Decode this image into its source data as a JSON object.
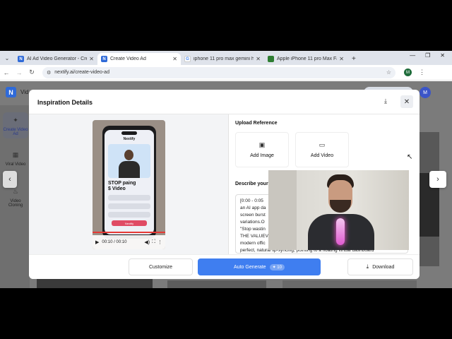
{
  "browser": {
    "tabs": [
      {
        "label": "AI Ad Video Generator - Create",
        "active": false,
        "favicon": "N",
        "favicon_color": "#2f6ad8"
      },
      {
        "label": "Create Video Ad",
        "active": true,
        "favicon": "N",
        "favicon_color": "#2f6ad8"
      },
      {
        "label": "iphone 11 pro max gemini help",
        "active": false,
        "favicon": "G",
        "favicon_color": "#4285f4"
      },
      {
        "label": "Apple iPhone 11 pro Max Facto",
        "active": false,
        "favicon": "",
        "favicon_color": "#2e7d32"
      }
    ],
    "close_glyph": "✕",
    "new_tab": "+",
    "url": "nextify.ai/create-video-ad",
    "profile_initial": "M"
  },
  "app": {
    "logo": "N",
    "name": "Vid",
    "user_initial": "M"
  },
  "sidebar": {
    "items": [
      {
        "label": "Create Video Ad",
        "icon": "sparkle-icon"
      },
      {
        "label": "Viral Video",
        "icon": "film-icon"
      },
      {
        "label": "Video Cloning",
        "icon": "flame-icon"
      }
    ]
  },
  "modal": {
    "title": "Inspiration Details",
    "upload_reference_label": "Upload Reference",
    "add_image_label": "Add Image",
    "add_video_label": "Add Video",
    "describe_label": "Describe your",
    "description": "[0:00 - 0:05\nan AI app da\nscreen burst\nvariations.O\n\"Stop wastin\nTHE VALUEV\nmodern offic\nperfect, natural lip-syncing, pointing to a floating virtual dashboard",
    "customize_label": "Customize",
    "auto_generate_label": "Auto Generate",
    "auto_generate_credits": "10",
    "download_label": "Download"
  },
  "video": {
    "time": "00:10 / 00:10",
    "progress": 1.0,
    "phone_brand": "Nextify",
    "phone_headline": "STOP paing\n$ Video",
    "phone_cta": "Nextify"
  },
  "colors": {
    "accent": "#3f7ef0",
    "brand": "#2f6ad8",
    "progress": "#e53935"
  }
}
